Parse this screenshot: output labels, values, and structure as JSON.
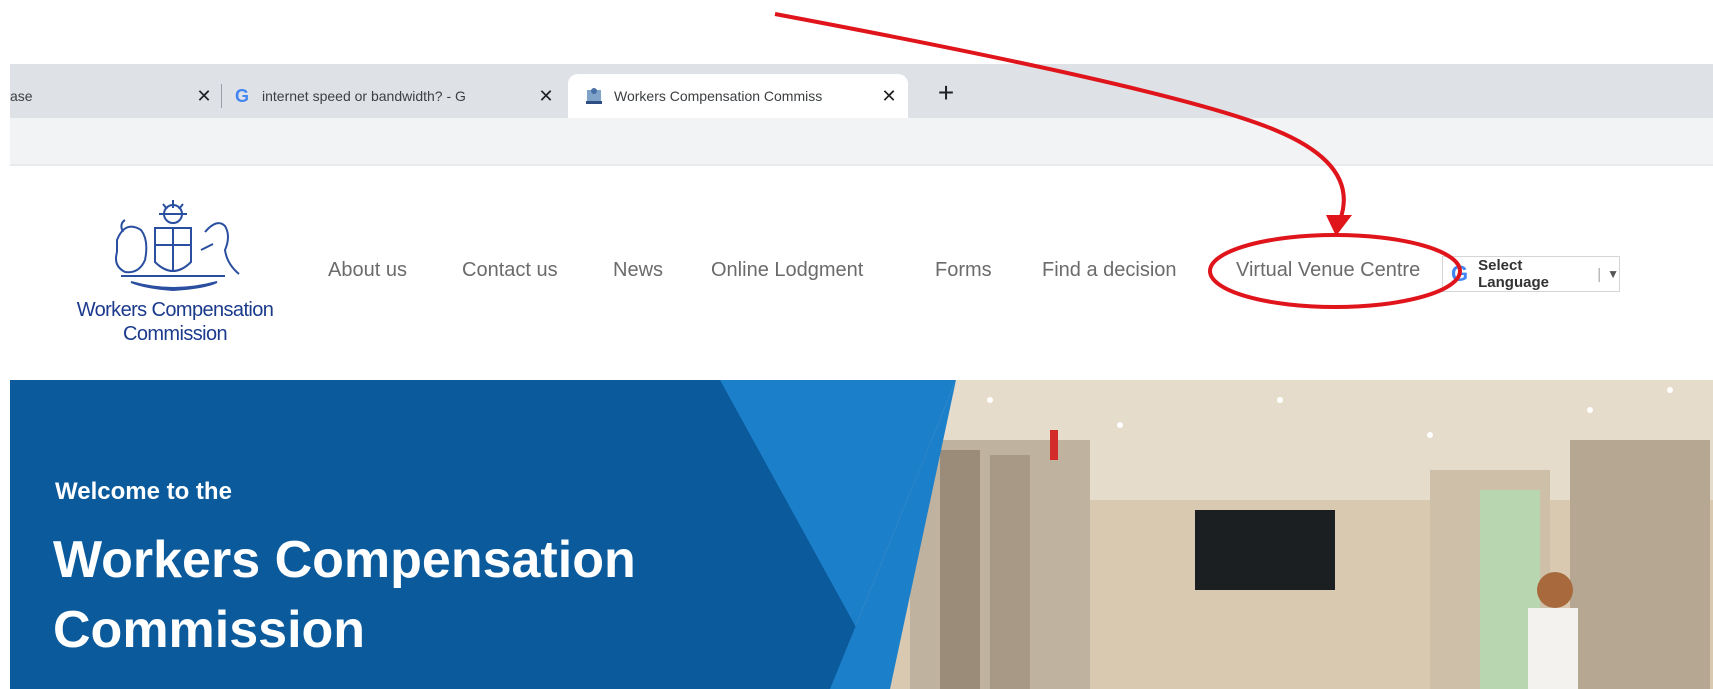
{
  "browser": {
    "tabs": [
      {
        "title": "ase",
        "active": false,
        "favicon": "none"
      },
      {
        "title": "internet speed or bandwidth? - G",
        "active": false,
        "favicon": "google-g-icon"
      },
      {
        "title": "Workers Compensation Commiss",
        "active": true,
        "favicon": "nsw-crest-icon"
      }
    ],
    "close_glyph": "✕",
    "new_tab_glyph": "+"
  },
  "site": {
    "logo_text": "Workers Compensation Commission",
    "nav": [
      "About us",
      "Contact us",
      "News",
      "Online Lodgment",
      "Forms",
      "Find a decision",
      "Virtual Venue Centre"
    ],
    "language": {
      "g_glyph": "G",
      "label": "Select Language",
      "separator": "|",
      "arrow": "▼"
    }
  },
  "hero": {
    "welcome": "Welcome to the",
    "title": "Workers Compensation Commission"
  },
  "colors": {
    "hero_dark_blue": "#0a5a9c",
    "hero_light_blue": "#1c7fc9",
    "annotation_red": "#e0141b",
    "logo_blue": "#1b3a8c"
  }
}
